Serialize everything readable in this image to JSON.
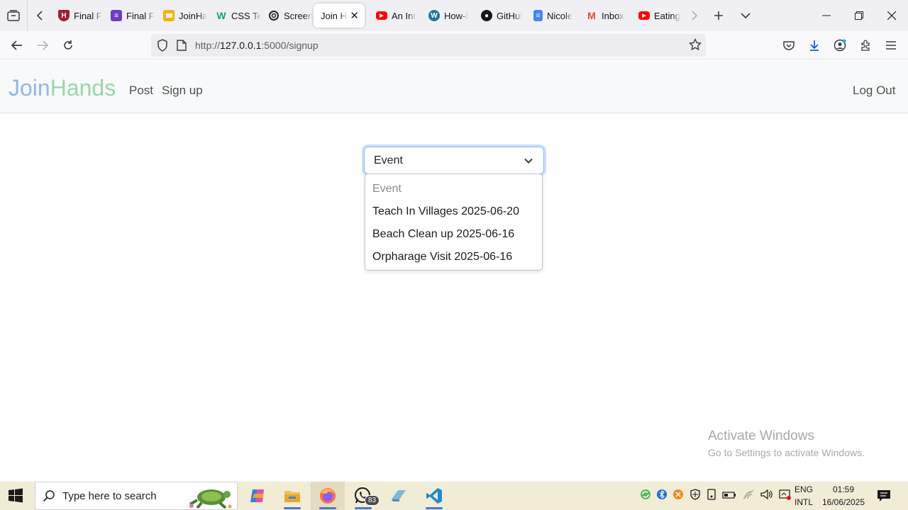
{
  "browser": {
    "tabs": [
      {
        "label": "Final F",
        "icon": "harvard-shield-icon",
        "color": "#a51c30"
      },
      {
        "label": "Final F",
        "icon": "notes-icon",
        "color": "#6c3cc1"
      },
      {
        "label": "JoinHa",
        "icon": "slides-icon",
        "color": "#f4b400"
      },
      {
        "label": "CSS Te",
        "icon": "w3schools-icon",
        "color": "#04aa6d"
      },
      {
        "label": "Screen",
        "icon": "openai-icon",
        "color": "#222222"
      },
      {
        "label": "Join Ha",
        "icon": "page-icon",
        "color": "#ffffff",
        "active": true
      },
      {
        "label": "An Int",
        "icon": "youtube-icon",
        "color": "#ff0000"
      },
      {
        "label": "How-I",
        "icon": "wordpress-icon",
        "color": "#21759b"
      },
      {
        "label": "GitHul",
        "icon": "github-icon",
        "color": "#181717"
      },
      {
        "label": "Nicole",
        "icon": "docs-icon",
        "color": "#4285f4"
      },
      {
        "label": "Inbox",
        "icon": "gmail-icon",
        "color": "#ea4335"
      },
      {
        "label": "Eating",
        "icon": "youtube-icon",
        "color": "#ff0000"
      }
    ],
    "url_prefix": "http://",
    "url_host": "127.0.0.1",
    "url_rest": ":5000/signup"
  },
  "site": {
    "brand_part1": "Join",
    "brand_part2": "Hands",
    "nav": {
      "post": "Post",
      "signup": "Sign up",
      "logout": "Log Out"
    },
    "brand_colors": {
      "join": "#8eb8e5",
      "hands": "#98d8a8"
    }
  },
  "form": {
    "selected": "Event",
    "options": [
      "Event",
      "Teach In Villages 2025-06-20",
      "Beach Clean up 2025-06-16",
      "Orpharage Visit 2025-06-16"
    ]
  },
  "watermark": {
    "title": "Activate Windows",
    "subtitle": "Go to Settings to activate Windows."
  },
  "taskbar": {
    "search_placeholder": "Type here to search",
    "whatsapp_badge": "83",
    "lang_line1": "ENG",
    "lang_line2": "INTL",
    "time": "01:59",
    "date": "16/06/2025"
  }
}
